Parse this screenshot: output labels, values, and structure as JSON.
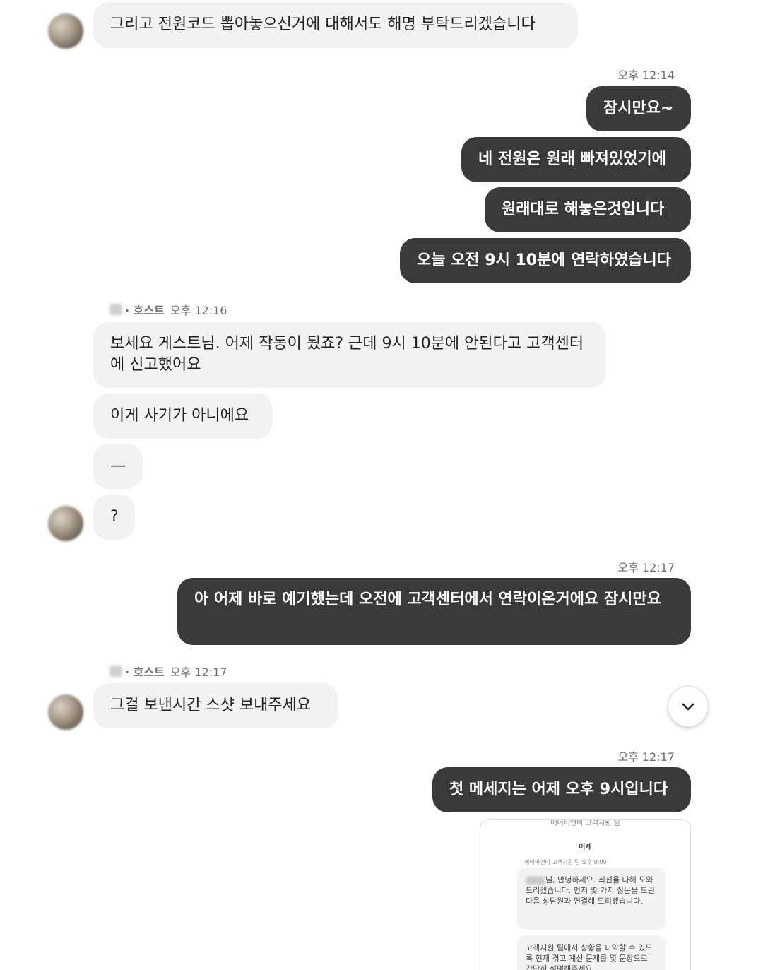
{
  "messages": {
    "m1": "그리고 전원코드 뽑아놓으신거에 대해서도 해명 부탁드리겠습니다",
    "t1": "오후 12:14",
    "m2": "잠시만요~",
    "m3": "네 전원은 원래 빠져있었기에",
    "m4": "원래대로 해놓은것입니다",
    "m5": "오늘 오전 9시 10분에 연락하였습니다",
    "s1_role": "· 호스트",
    "s1_time": "오후 12:16",
    "m6": "보세요 게스트님. 어제 작동이 됬죠? 근데 9시 10분에 안된다고 고객센터에 신고했어요",
    "m7": "이게 사기가 아니에요",
    "m8": "—",
    "m9": "?",
    "t2": "오후 12:17",
    "m10": "아 어제 바로 예기했는데 오전에 고객센터에서 연락이온거에요 잠시만요",
    "s2_role": "· 호스트",
    "s2_time": "오후 12:17",
    "m11": "그걸 보낸시간 스샷 보내주세요",
    "t3": "오후 12:17",
    "m12": "첫 메세지는 어제 오후 9시입니다"
  },
  "attachment": {
    "header": "에어비앤비 고객지원 팀",
    "date": "어제",
    "meta": "에어비앤비 고객지원 팀 오후 9:00",
    "msg1": "님, 안녕하세요. 최선을 다해 도와드리겠습니다. 먼저 몇 가지 질문을 드린 다음 상담원과 연결해 드리겠습니다.",
    "msg2": "고객지원 팀에서 상황을 파악할 수 있도록 현재 겪고 계신 문제를 몇 문장으로 간단히 설명해주세요."
  },
  "icons": {
    "scroll_down": "chevron-down-icon"
  }
}
